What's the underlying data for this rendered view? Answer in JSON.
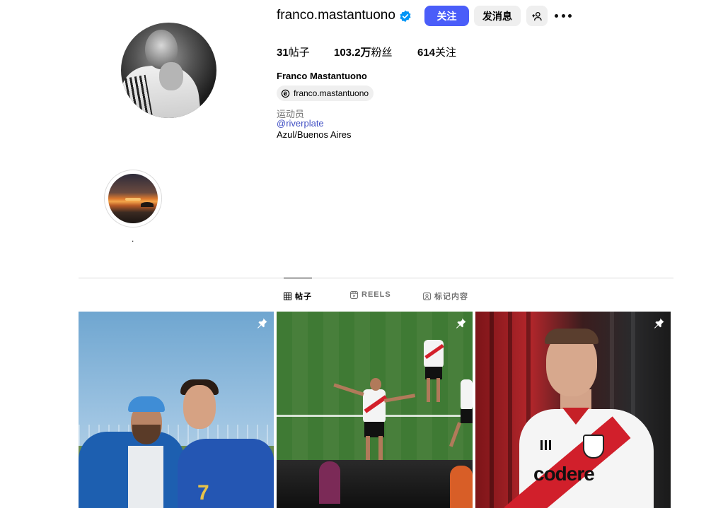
{
  "profile": {
    "username": "franco.mastantuono",
    "follow_label": "关注",
    "message_label": "发消息",
    "stats": {
      "posts_num": "31",
      "posts_label": "帖子",
      "followers_num": "103.2万",
      "followers_label": "粉丝",
      "following_num": "614",
      "following_label": "关注"
    },
    "full_name": "Franco Mastantuono",
    "threads_handle": "franco.mastantuono",
    "category": "运动员",
    "mention": "@riverplate",
    "location": "Azul/Buenos Aires"
  },
  "highlights": [
    {
      "label": "."
    }
  ],
  "tabs": [
    {
      "label": "帖子",
      "icon": "grid-icon",
      "active": true
    },
    {
      "label": "REELS",
      "icon": "reels-icon",
      "active": false
    },
    {
      "label": "标记内容",
      "icon": "tagged-icon",
      "active": false
    }
  ],
  "posts": [
    {
      "pinned": true,
      "icon": "pin-icon",
      "overlay_text": "7"
    },
    {
      "pinned": true,
      "icon": "pin-icon"
    },
    {
      "pinned": true,
      "icon": "pin-icon",
      "overlay_text": "codere"
    }
  ],
  "colors": {
    "accent": "#4a5df9",
    "link": "#4150c4",
    "verified": "#0095f6"
  }
}
